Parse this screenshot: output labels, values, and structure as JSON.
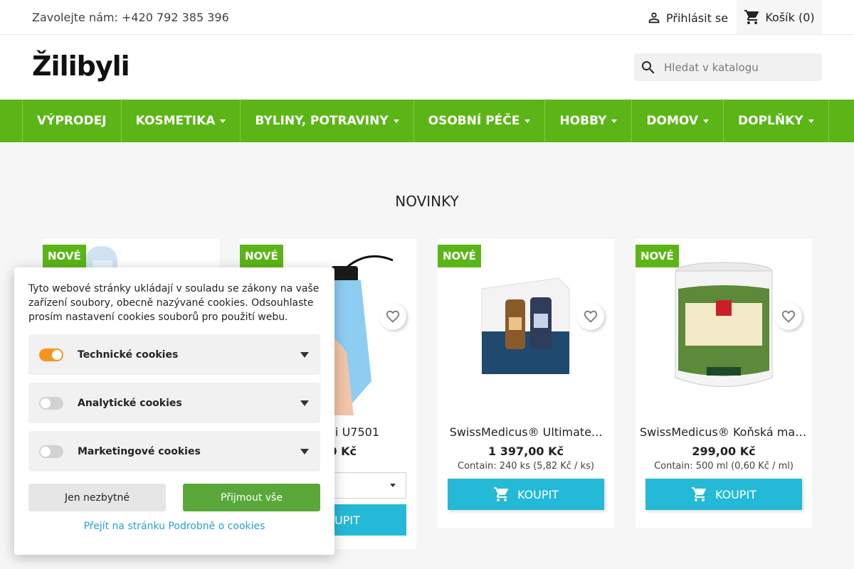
{
  "topbar": {
    "contact": "Zavolejte nám: +420 792 385 396",
    "login_label": "Přihlásit se",
    "cart_label": "Košík (0)"
  },
  "header": {
    "logo": "Žilibyli",
    "search_placeholder": "Hledat v katalogu"
  },
  "nav": {
    "items": [
      {
        "label": "VÝPRODEJ"
      },
      {
        "label": "KOSMETIKA"
      },
      {
        "label": "BYLINY, POTRAVINY"
      },
      {
        "label": "OSOBNÍ PÉČE"
      },
      {
        "label": "HOBBY"
      },
      {
        "label": "DOMOV"
      },
      {
        "label": "DOPLŇKY"
      }
    ]
  },
  "section": {
    "title": "NOVINKY"
  },
  "products": [
    {
      "badge": "NOVÉ"
    },
    {
      "badge": "NOVÉ",
      "name_partial": "ni U7501",
      "price_partial": "0 Kč",
      "buy_partial": "UPIT"
    },
    {
      "badge": "NOVÉ",
      "name": "SwissMedicus® Ultimate...",
      "price": "1 397,00 Kč",
      "contain": "Contain: 240 ks (5,82 Kč / ks)",
      "buy": "KOUPIT"
    },
    {
      "badge": "NOVÉ",
      "name": "SwissMedicus® Koňská mast...",
      "price": "299,00 Kč",
      "contain": "Contain: 500 ml (0,60 Kč / ml)",
      "buy": "KOUPIT"
    }
  ],
  "cookie": {
    "intro": "Tyto webové stránky ukládají v souladu se zákony na vaše zařízení soubory, obecně nazývané cookies. Odsouhlaste prosím nastavení cookies souborů pro použití webu.",
    "rows": [
      {
        "label": "Technické cookies",
        "enabled": true
      },
      {
        "label": "Analytické cookies",
        "enabled": false
      },
      {
        "label": "Marketingové cookies",
        "enabled": false
      }
    ],
    "btn_essential": "Jen nezbytné",
    "btn_accept": "Přijmout vše",
    "link": "Přejít na stránku Podrobně o cookies"
  },
  "colors": {
    "brand_green": "#5bb516",
    "buy_blue": "#24b9d7",
    "accept_green": "#5aa83a",
    "toggle_on": "#f7941d",
    "link_blue": "#24a3c9"
  }
}
